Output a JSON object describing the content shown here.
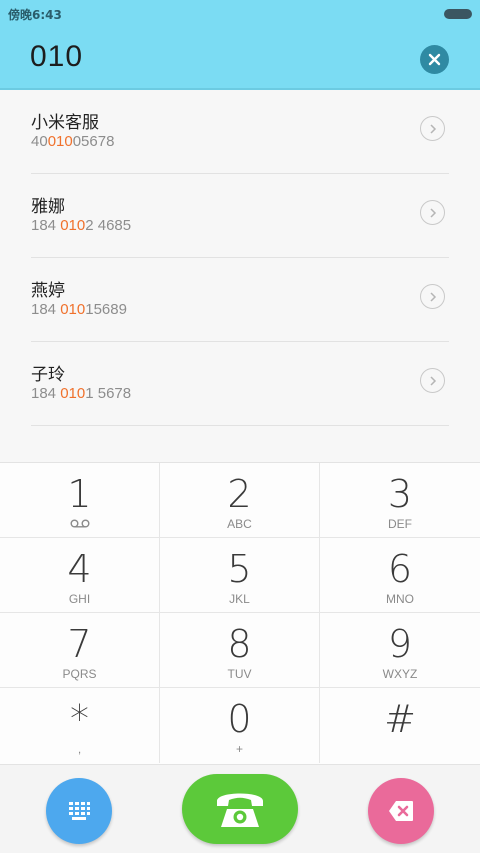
{
  "status": {
    "time": "傍晚6:43"
  },
  "search": {
    "query": "010"
  },
  "results": [
    {
      "name": "小米客服",
      "num_pre": "40",
      "num_hl": "010",
      "num_post": "05678"
    },
    {
      "name": "雅娜",
      "num_pre": "184 ",
      "num_hl": "010",
      "num_post": "2 4685"
    },
    {
      "name": "燕婷",
      "num_pre": "184 ",
      "num_hl": "010",
      "num_post": "15689"
    },
    {
      "name": "子玲",
      "num_pre": "184 ",
      "num_hl": "010",
      "num_post": "1 5678"
    }
  ],
  "keys": [
    {
      "digit": "1",
      "letters": ""
    },
    {
      "digit": "2",
      "letters": "ABC"
    },
    {
      "digit": "3",
      "letters": "DEF"
    },
    {
      "digit": "4",
      "letters": "GHI"
    },
    {
      "digit": "5",
      "letters": "JKL"
    },
    {
      "digit": "6",
      "letters": "MNO"
    },
    {
      "digit": "7",
      "letters": "PQRS"
    },
    {
      "digit": "8",
      "letters": "TUV"
    },
    {
      "digit": "9",
      "letters": "WXYZ"
    },
    {
      "digit": "*",
      "letters": ","
    },
    {
      "digit": "0",
      "letters": "+"
    },
    {
      "digit": "#",
      "letters": ""
    }
  ],
  "colors": {
    "header": "#7bdcf3",
    "highlight": "#f0712c",
    "dialpad_button": "#4da8ee",
    "call_button": "#5cc93a",
    "delete_button": "#ea6a9a"
  },
  "icons": {
    "clear": "close-icon",
    "row": "chevron-right-icon",
    "key_1": "voicemail-icon",
    "dialpad": "dialpad-icon",
    "call": "phone-icon",
    "delete": "backspace-icon"
  }
}
